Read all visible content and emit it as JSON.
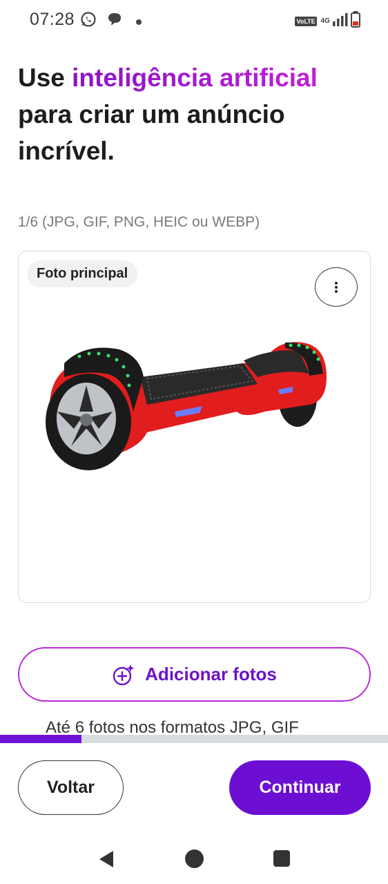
{
  "status_bar": {
    "time": "07:28",
    "left_icons": [
      "whatsapp-icon",
      "chat-bubble-icon",
      "dot-icon"
    ],
    "volte_label": "VoLTE",
    "network_label": "4G",
    "right_icons": [
      "signal-icon",
      "battery-low-icon"
    ]
  },
  "heading": {
    "prefix": "Use ",
    "accent": "inteligência artificial",
    "suffix": " para criar um anúncio incrível."
  },
  "photos": {
    "counter": "1/6 (JPG, GIF, PNG, HEIC ou WEBP)",
    "main_badge": "Foto principal",
    "more_icon": "more-vertical-icon",
    "product_image": "hoverboard-red-image"
  },
  "add_photos": {
    "label": "Adicionar fotos",
    "icon": "sparkle-plus-icon"
  },
  "hint": "Até 6 fotos nos formatos JPG, GIF",
  "progress": {
    "value": 0.21
  },
  "actions": {
    "back_label": "Voltar",
    "continue_label": "Continuar"
  },
  "colors": {
    "accent_purple": "#6c0fd3",
    "accent_magenta": "#c21fd8",
    "progress_track": "#d8dbe0"
  },
  "nav": {
    "back_icon": "nav-back-icon",
    "home_icon": "nav-home-icon",
    "recents_icon": "nav-recents-icon"
  }
}
